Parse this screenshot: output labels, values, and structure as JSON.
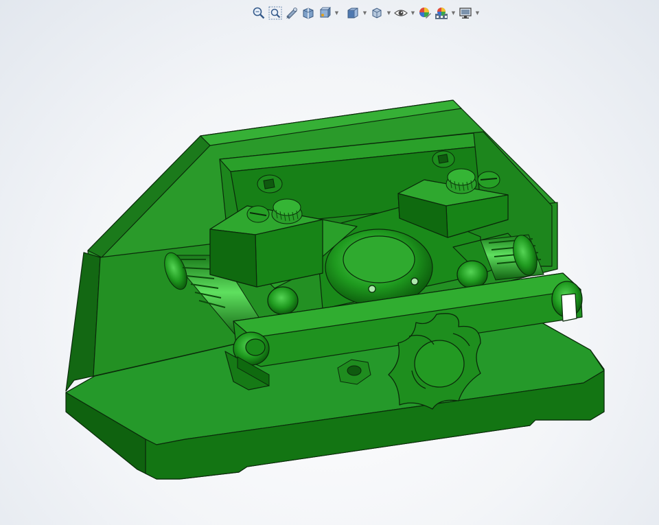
{
  "app": {
    "title": ""
  },
  "toolbar": {
    "items": [
      {
        "icon": "zoom-to-fit-icon",
        "has_dropdown": false
      },
      {
        "icon": "zoom-to-area-icon",
        "has_dropdown": false
      },
      {
        "icon": "previous-view-icon",
        "has_dropdown": false
      },
      {
        "icon": "section-view-icon",
        "has_dropdown": false
      },
      {
        "icon": "dynamic-annotation-views-icon",
        "has_dropdown": true
      },
      {
        "icon": "view-orientation-icon",
        "has_dropdown": true
      },
      {
        "icon": "display-style-icon",
        "has_dropdown": true
      },
      {
        "icon": "hide-show-items-icon",
        "has_dropdown": true
      },
      {
        "icon": "edit-appearance-icon",
        "has_dropdown": false
      },
      {
        "icon": "apply-scene-icon",
        "has_dropdown": true
      },
      {
        "icon": "view-settings-icon",
        "has_dropdown": true
      }
    ]
  },
  "model": {
    "description": "",
    "colors": {
      "body": "#1f8a1f",
      "body_light": "#35a835",
      "body_dark": "#0f5a0f",
      "edge": "#0a2a0a"
    }
  }
}
